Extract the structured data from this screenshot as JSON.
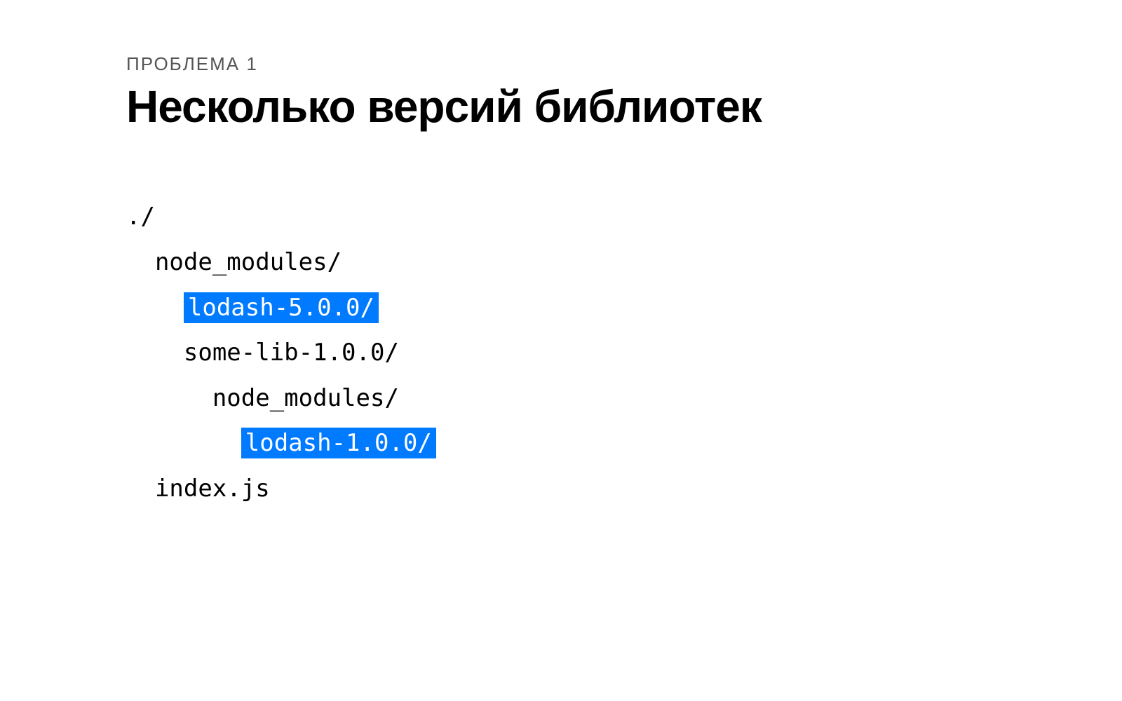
{
  "eyebrow": "ПРОБЛЕМА 1",
  "title": "Несколько версий библиотек",
  "tree": {
    "lines": [
      {
        "indent": 0,
        "segments": [
          {
            "text": "./",
            "highlight": false
          }
        ]
      },
      {
        "indent": 1,
        "segments": [
          {
            "text": "node_modules/",
            "highlight": false
          }
        ]
      },
      {
        "indent": 2,
        "segments": [
          {
            "text": "lodash-5.0.0/",
            "highlight": true
          }
        ]
      },
      {
        "indent": 2,
        "segments": [
          {
            "text": "some-lib-1.0.0/",
            "highlight": false
          }
        ]
      },
      {
        "indent": 3,
        "segments": [
          {
            "text": "node_modules/",
            "highlight": false
          }
        ]
      },
      {
        "indent": 4,
        "segments": [
          {
            "text": "lodash-1.0.0/",
            "highlight": true
          }
        ]
      },
      {
        "indent": 1,
        "segments": [
          {
            "text": "index.js",
            "highlight": false
          }
        ]
      }
    ],
    "indent_unit": "  "
  }
}
